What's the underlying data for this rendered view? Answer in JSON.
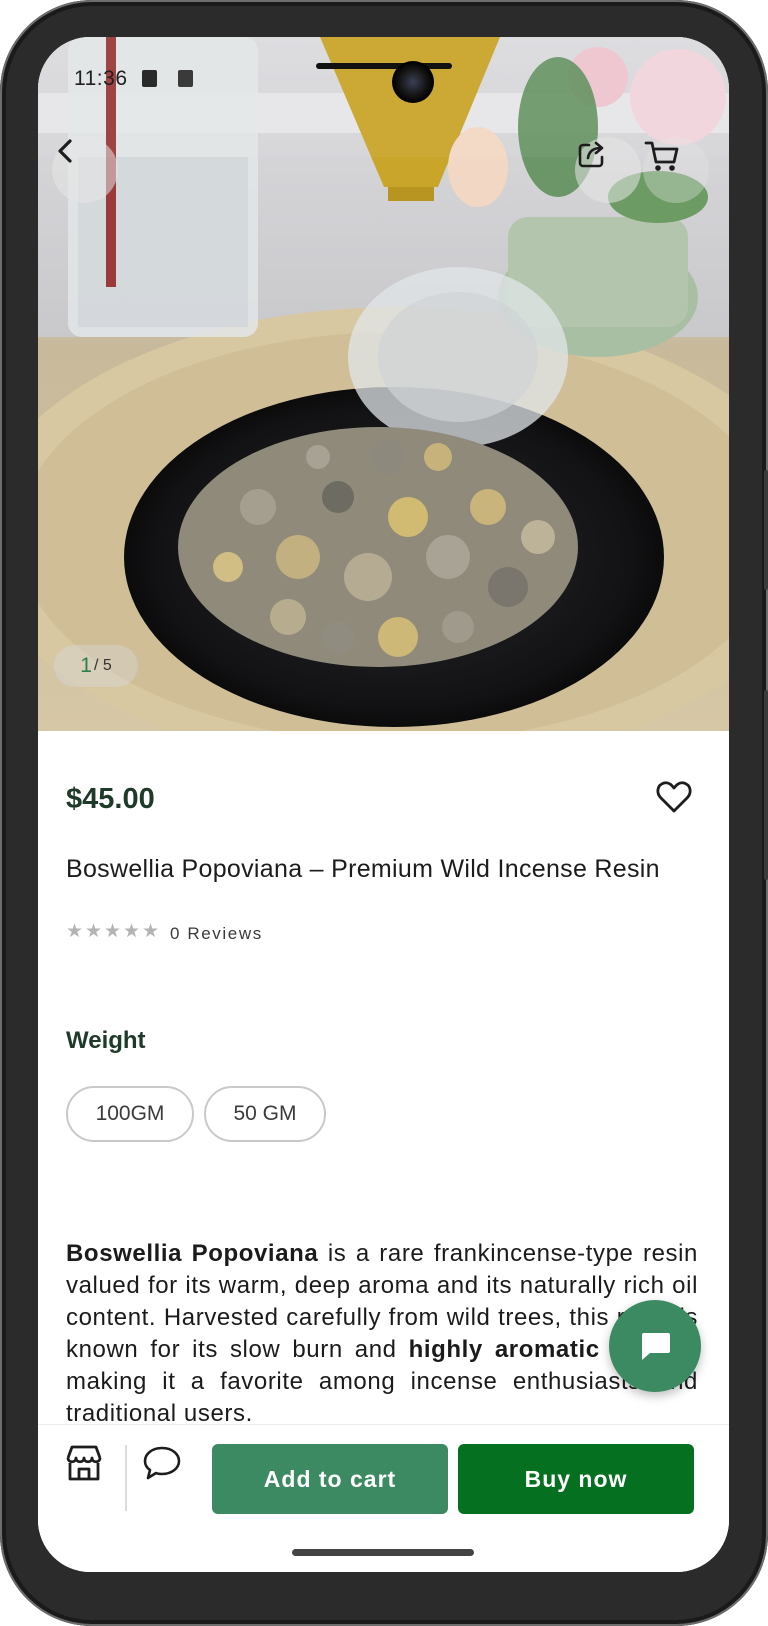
{
  "status_bar": {
    "time": "11:36"
  },
  "gallery": {
    "current": "1",
    "separator_total": "/ 5"
  },
  "product": {
    "price": "$45.00",
    "title": "Boswellia Popoviana – Premium Wild Incense Resin",
    "rating": 0,
    "reviews_label": "0 Reviews"
  },
  "weight": {
    "label": "Weight",
    "options": [
      "100GM",
      "50 GM"
    ]
  },
  "description": {
    "strong1": "Boswellia Popoviana",
    "text1": " is a rare frankincense-type resin valued for its warm, deep aroma and its naturally rich oil content. Harvested carefully from wild trees, this resin is known for its slow burn and ",
    "strong2": "highly aromatic smoke",
    "text2": ", making it a favorite among incense enthusiasts and traditional users."
  },
  "actions": {
    "add_to_cart": "Add to cart",
    "buy_now": "Buy now"
  },
  "colors": {
    "accent_green": "#3c8a61",
    "buy_now_green": "#05701f",
    "price_text": "#1e3b2a"
  },
  "icons": {
    "back": "chevron-left-icon",
    "share": "share-icon",
    "cart": "cart-icon",
    "favorite": "heart-icon",
    "store": "store-icon",
    "chat": "chat-bubble-icon",
    "fab": "message-icon"
  }
}
